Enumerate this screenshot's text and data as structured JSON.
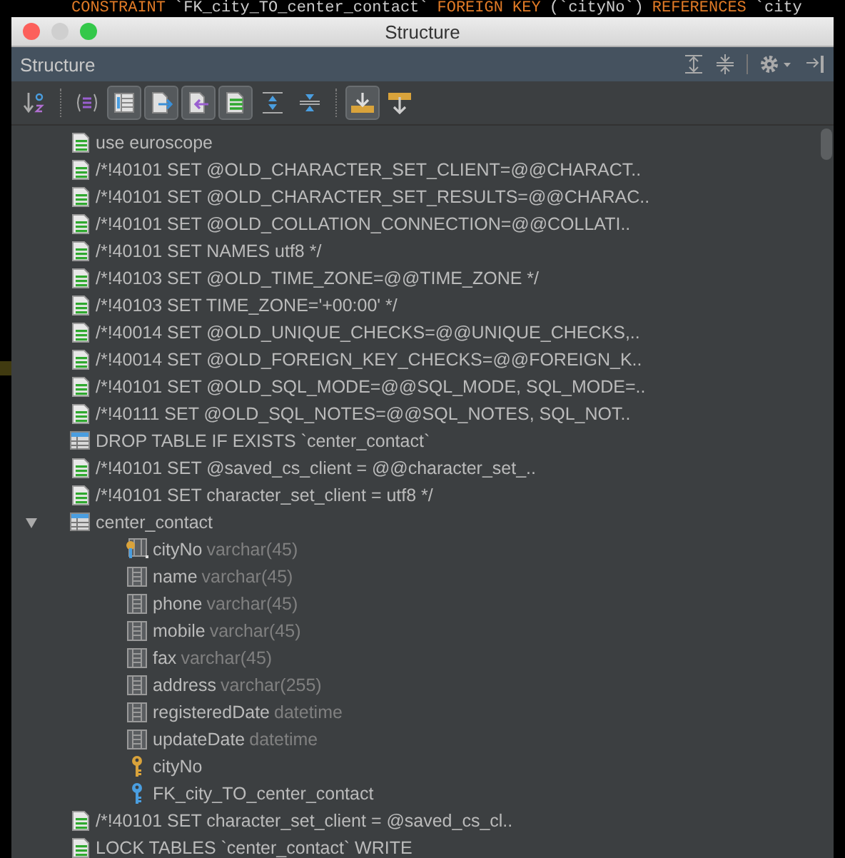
{
  "editor_line": [
    {
      "text": "CONSTRAINT",
      "kind": "keyword"
    },
    {
      "text": "`FK_city_TO_center_contact`",
      "kind": "plain"
    },
    {
      "text": "FOREIGN KEY",
      "kind": "keyword"
    },
    {
      "text": "(`cityNo`)",
      "kind": "plain"
    },
    {
      "text": "REFERENCES",
      "kind": "keyword"
    },
    {
      "text": "`city",
      "kind": "plain"
    }
  ],
  "window": {
    "title": "Structure"
  },
  "panel": {
    "title": "Structure",
    "actions": [
      {
        "kind": "expand"
      },
      {
        "kind": "collapse"
      },
      {
        "kind": "gear"
      },
      {
        "kind": "hide"
      }
    ]
  },
  "toolbar": [
    {
      "kind": "sort",
      "pressed": false
    },
    {
      "kind": "fields",
      "pressed": false
    },
    {
      "kind": "table",
      "pressed": true
    },
    {
      "kind": "export",
      "pressed": true
    },
    {
      "kind": "import",
      "pressed": true
    },
    {
      "kind": "list",
      "pressed": true
    },
    {
      "kind": "expand",
      "pressed": false
    },
    {
      "kind": "collapse",
      "pressed": false
    },
    {
      "kind": "autoscroll_to",
      "pressed": true
    },
    {
      "kind": "autoscroll_from",
      "pressed": false
    }
  ],
  "tree": [
    {
      "kind": "statement",
      "label": "use euroscope"
    },
    {
      "kind": "statement",
      "label": "/*!40101 SET @OLD_CHARACTER_SET_CLIENT=@@CHARACT.."
    },
    {
      "kind": "statement",
      "label": "/*!40101 SET @OLD_CHARACTER_SET_RESULTS=@@CHARAC.."
    },
    {
      "kind": "statement",
      "label": "/*!40101 SET @OLD_COLLATION_CONNECTION=@@COLLATI.."
    },
    {
      "kind": "statement",
      "label": "/*!40101 SET NAMES utf8 */"
    },
    {
      "kind": "statement",
      "label": "/*!40103 SET @OLD_TIME_ZONE=@@TIME_ZONE */"
    },
    {
      "kind": "statement",
      "label": "/*!40103 SET TIME_ZONE='+00:00' */"
    },
    {
      "kind": "statement",
      "label": "/*!40014 SET @OLD_UNIQUE_CHECKS=@@UNIQUE_CHECKS,.."
    },
    {
      "kind": "statement",
      "label": "/*!40014 SET @OLD_FOREIGN_KEY_CHECKS=@@FOREIGN_K.."
    },
    {
      "kind": "statement",
      "label": "/*!40101 SET @OLD_SQL_MODE=@@SQL_MODE, SQL_MODE=.."
    },
    {
      "kind": "statement",
      "label": "/*!40111 SET @OLD_SQL_NOTES=@@SQL_NOTES, SQL_NOT.."
    },
    {
      "kind": "drop",
      "label": "DROP TABLE IF EXISTS `center_contact`"
    },
    {
      "kind": "statement",
      "label": "/*!40101 SET @saved_cs_client = @@character_set_.."
    },
    {
      "kind": "statement",
      "label": "/*!40101 SET character_set_client = utf8 */"
    },
    {
      "kind": "table",
      "label": "center_contact",
      "expanded": true,
      "children": [
        {
          "kind": "key_column",
          "label": "cityNo",
          "type": "varchar(45)"
        },
        {
          "kind": "column",
          "label": "name",
          "type": "varchar(45)"
        },
        {
          "kind": "column",
          "label": "phone",
          "type": "varchar(45)"
        },
        {
          "kind": "column",
          "label": "mobile",
          "type": "varchar(45)"
        },
        {
          "kind": "column",
          "label": "fax",
          "type": "varchar(45)"
        },
        {
          "kind": "column",
          "label": "address",
          "type": "varchar(255)"
        },
        {
          "kind": "column",
          "label": "registeredDate",
          "type": "datetime"
        },
        {
          "kind": "column",
          "label": "updateDate",
          "type": "datetime"
        },
        {
          "kind": "key",
          "label": "cityNo"
        },
        {
          "kind": "foreign_key",
          "label": "FK_city_TO_center_contact"
        }
      ]
    },
    {
      "kind": "statement",
      "label": "/*!40101 SET character_set_client = @saved_cs_cl.."
    },
    {
      "kind": "statement",
      "label": "LOCK TABLES `center_contact` WRITE"
    }
  ]
}
